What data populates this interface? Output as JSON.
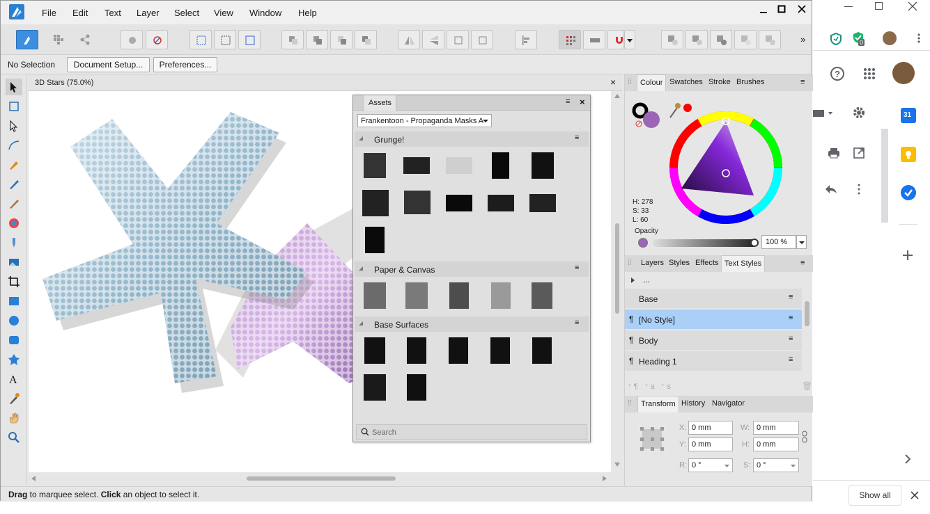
{
  "menu": [
    "File",
    "Edit",
    "Text",
    "Layer",
    "Select",
    "View",
    "Window",
    "Help"
  ],
  "context_bar": {
    "selection": "No Selection",
    "document_setup": "Document Setup...",
    "preferences": "Preferences..."
  },
  "document": {
    "tab_title": "3D Stars (75.0%)",
    "close": "×"
  },
  "assets": {
    "title": "Assets",
    "category": "Frankentoon - Propaganda Masks A",
    "sections": [
      "Grunge!",
      "Paper & Canvas",
      "Base Surfaces"
    ],
    "search_placeholder": "Search"
  },
  "colour_panel": {
    "tabs": [
      "Colour",
      "Swatches",
      "Stroke",
      "Brushes"
    ],
    "h": "H: 278",
    "s": "S: 33",
    "l": "L: 60",
    "opacity_label": "Opacity",
    "opacity_value": "100 %",
    "fill_color": "#9b66b5",
    "accent_red": "#ff0000"
  },
  "styles_panel": {
    "tabs": [
      "Layers",
      "Styles",
      "Effects",
      "Text Styles"
    ],
    "ellipsis": "...",
    "items": [
      "Base",
      "[No Style]",
      "Body",
      "Heading 1"
    ]
  },
  "transform_panel": {
    "tabs": [
      "Transform",
      "History",
      "Navigator"
    ],
    "x_label": "X:",
    "y_label": "Y:",
    "w_label": "W:",
    "h_label": "H:",
    "r_label": "R:",
    "s_label": "S:",
    "x": "0 mm",
    "y": "0 mm",
    "w": "0 mm",
    "h": "0 mm",
    "r": "0 °",
    "s": "0 °"
  },
  "status": {
    "bold1": "Drag",
    "text1": " to marquee select. ",
    "bold2": "Click",
    "text2": " an object to select it."
  },
  "browser": {
    "badge_count": "0",
    "calendar_day": "31",
    "show_all": "Show all"
  }
}
